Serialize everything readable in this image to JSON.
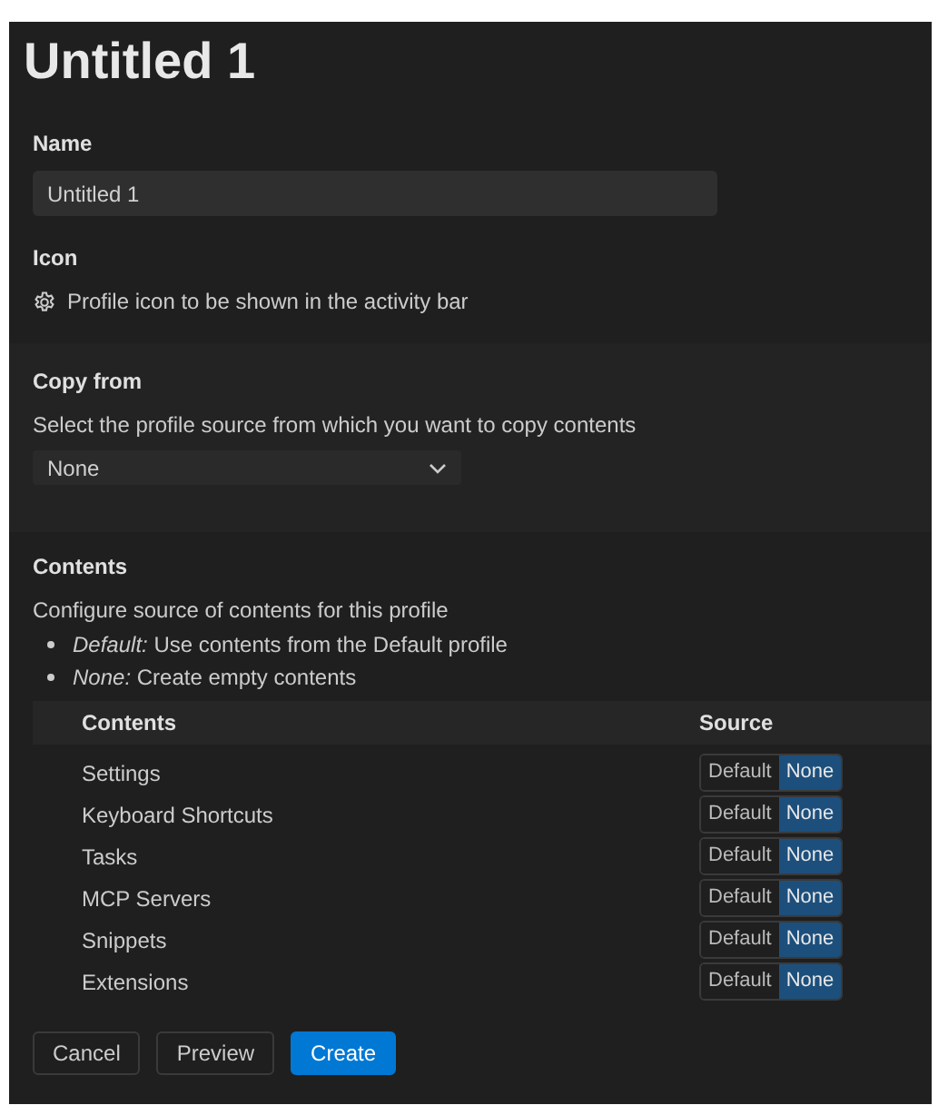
{
  "title": "Untitled 1",
  "name": {
    "label": "Name",
    "value": "Untitled 1"
  },
  "icon": {
    "label": "Icon",
    "description": "Profile icon to be shown in the activity bar"
  },
  "copy_from": {
    "label": "Copy from",
    "description": "Select the profile source from which you want to copy contents",
    "value": "None"
  },
  "contents": {
    "label": "Contents",
    "description": "Configure source of contents for this profile",
    "bullets": [
      "*Default:* Use contents from the Default profile",
      "*None:* Create empty contents"
    ],
    "columns": [
      "Contents",
      "Source"
    ],
    "rows": [
      {
        "label": "Settings",
        "options": [
          {
            "label": "Default",
            "selected": false
          },
          {
            "label": "None",
            "selected": true
          }
        ]
      },
      {
        "label": "Keyboard Shortcuts",
        "options": [
          {
            "label": "Default",
            "selected": false
          },
          {
            "label": "None",
            "selected": true
          }
        ]
      },
      {
        "label": "Tasks",
        "options": [
          {
            "label": "Default",
            "selected": false
          },
          {
            "label": "None",
            "selected": true
          }
        ]
      },
      {
        "label": "MCP Servers",
        "options": [
          {
            "label": "Default",
            "selected": false
          },
          {
            "label": "None",
            "selected": true
          }
        ]
      },
      {
        "label": "Snippets",
        "options": [
          {
            "label": "Default",
            "selected": false
          },
          {
            "label": "None",
            "selected": true
          }
        ]
      },
      {
        "label": "Extensions",
        "options": [
          {
            "label": "Default",
            "selected": false
          },
          {
            "label": "None",
            "selected": true
          }
        ]
      }
    ]
  },
  "buttons": [
    {
      "label": "Cancel",
      "kind": "secondary"
    },
    {
      "label": "Preview",
      "kind": "secondary"
    },
    {
      "label": "Create",
      "kind": "primary"
    }
  ]
}
